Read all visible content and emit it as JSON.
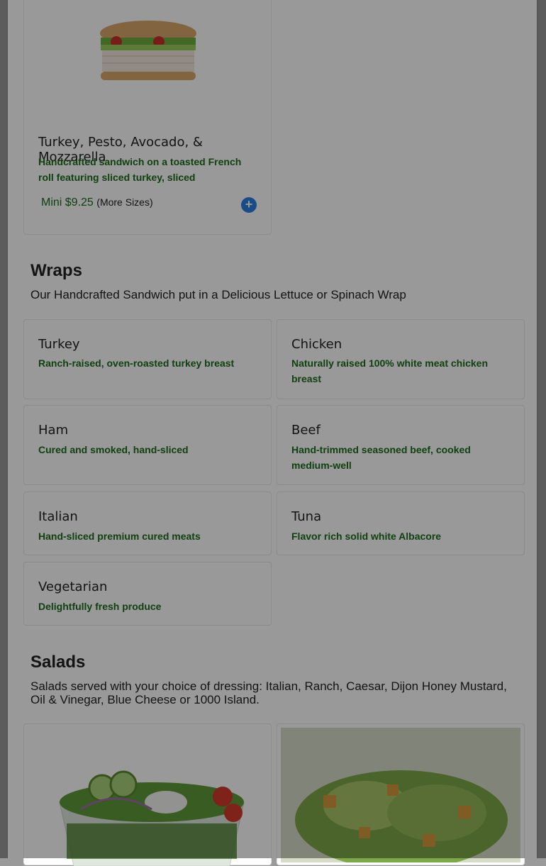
{
  "featured": {
    "title": "Turkey, Pesto, Avocado, & Mozzarella",
    "description": "Handcrafted sandwich on a toasted French roll featuring sliced turkey, sliced mozzarella,…",
    "price_label": "Mini $9.25",
    "more_sizes": "(More Sizes)",
    "add_icon": "+"
  },
  "wraps": {
    "title": "Wraps",
    "subtitle": "Our Handcrafted Sandwich put in a Delicious Lettuce or Spinach Wrap",
    "items": [
      {
        "name": "Turkey",
        "desc": "Ranch-raised, oven-roasted turkey breast"
      },
      {
        "name": "Chicken",
        "desc": "Naturally raised 100% white meat chicken breast"
      },
      {
        "name": "Ham",
        "desc": "Cured and smoked, hand-sliced"
      },
      {
        "name": "Beef",
        "desc": "Hand-trimmed seasoned beef, cooked medium-well"
      },
      {
        "name": "Italian",
        "desc": "Hand-sliced premium cured meats"
      },
      {
        "name": "Tuna",
        "desc": "Flavor rich solid white Albacore"
      },
      {
        "name": "Vegetarian",
        "desc": "Delightfully fresh produce"
      }
    ]
  },
  "salads": {
    "title": "Salads",
    "subtitle": "Salads served with your choice of dressing: Italian, Ranch, Caesar, Dijon Honey Mustard, Oil & Vinegar, Blue Cheese or 1000 Island."
  },
  "colors": {
    "description_green": "#1d6b1d",
    "add_button_blue": "#2a7de1",
    "modal_overlay": "rgba(0,0,0,0.40)"
  }
}
